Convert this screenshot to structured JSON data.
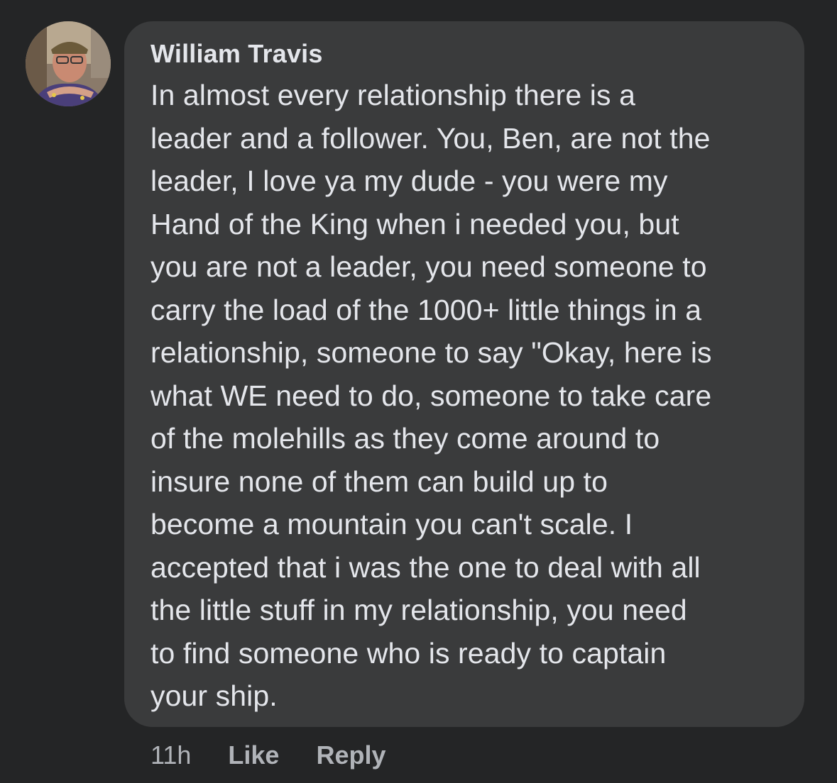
{
  "comment": {
    "author": "William Travis",
    "text": "In almost every relationship there is a\nleader and a follower.  You, Ben, are not the\nleader, I love ya my dude - you were my\nHand of the King when i needed you, but\nyou are not a leader, you need someone to\ncarry the load of the 1000+ little things in a\nrelationship, someone to say \"Okay, here is\nwhat WE need to do, someone to take care\nof the molehills as they come around to\ninsure none of them can build up to\nbecome a mountain you can't scale. I\naccepted that i was the one to deal with all\nthe little stuff in my relationship, you need\nto find someone who is ready to captain\nyour ship.",
    "timestamp": "11h",
    "like_label": "Like",
    "reply_label": "Reply"
  },
  "colors": {
    "background": "#242526",
    "bubble": "#3a3b3c",
    "text": "#e4e6eb",
    "meta": "#b0b3b8"
  },
  "icons": {
    "avatar": "profile-photo"
  }
}
